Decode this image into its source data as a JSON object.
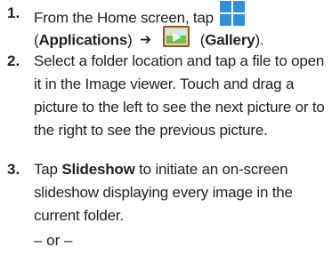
{
  "step1": {
    "number": "1.",
    "line1_text": "From the Home screen, tap",
    "open_paren": "(",
    "applications_label": "Applications",
    "close_paren": ")",
    "arrow": "➔",
    "open_paren2": "(",
    "gallery_label": "Gallery",
    "close_paren2": ").",
    "icons": [
      "applications-icon",
      "gallery-icon"
    ],
    "colors": {
      "applications_icon": "#2f8fdf",
      "gallery_frame": "#8a5a2b",
      "gallery_green": "#6cc04a"
    }
  },
  "step2": {
    "number": "2.",
    "lines": [
      "Select a folder location and tap a file to open",
      "it in the Image viewer. Touch and drag a",
      "picture to the left to see the next picture or to",
      "the right to see the previous picture."
    ]
  },
  "step3": {
    "number": "3.",
    "tap_word": "Tap ",
    "slideshow_label": "Slideshow",
    "line1_rest": " to initiate an on-screen",
    "lines": [
      "slideshow displaying every image in the",
      "current folder."
    ]
  },
  "or_text": "– or –"
}
